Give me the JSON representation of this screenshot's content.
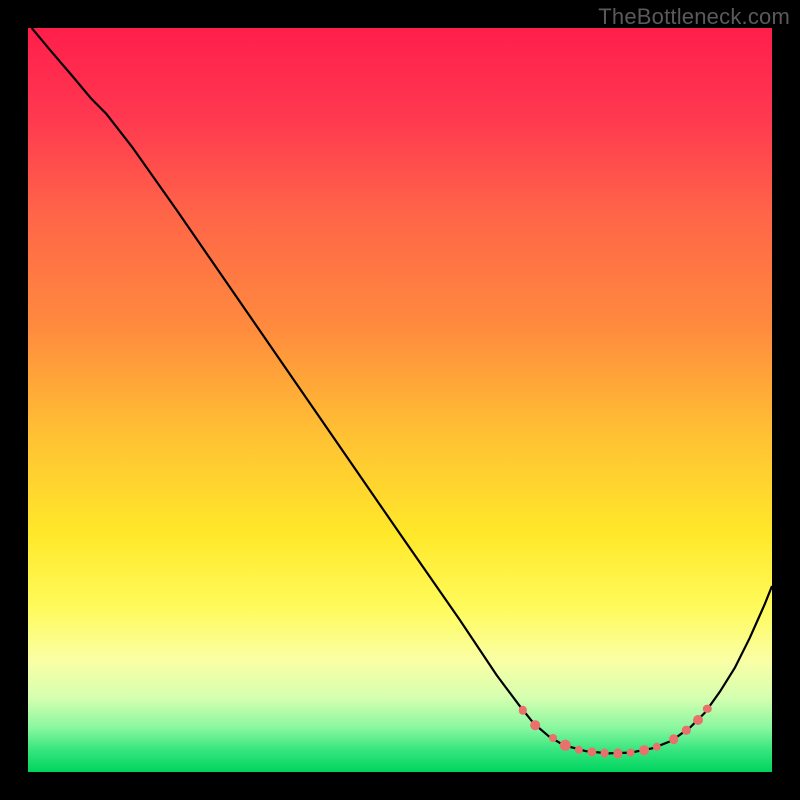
{
  "watermark": "TheBottleneck.com",
  "chart_data": {
    "type": "line",
    "title": "",
    "xlabel": "",
    "ylabel": "",
    "xlim": [
      0,
      100
    ],
    "ylim": [
      0,
      100
    ],
    "gradient_stops": [
      {
        "offset": 0,
        "color": "#ff1e4b"
      },
      {
        "offset": 12,
        "color": "#ff3850"
      },
      {
        "offset": 25,
        "color": "#ff6548"
      },
      {
        "offset": 40,
        "color": "#ff8a3e"
      },
      {
        "offset": 55,
        "color": "#ffc233"
      },
      {
        "offset": 68,
        "color": "#ffe82a"
      },
      {
        "offset": 78,
        "color": "#fffb5c"
      },
      {
        "offset": 85,
        "color": "#faffa5"
      },
      {
        "offset": 90,
        "color": "#d5ffb0"
      },
      {
        "offset": 94,
        "color": "#8bf7a0"
      },
      {
        "offset": 97,
        "color": "#37e67f"
      },
      {
        "offset": 100,
        "color": "#00d45e"
      }
    ],
    "series": [
      {
        "name": "bottleneck-curve",
        "color": "#000000",
        "points": [
          {
            "x": 0.5,
            "y": 100
          },
          {
            "x": 3,
            "y": 97
          },
          {
            "x": 6,
            "y": 93.5
          },
          {
            "x": 8.5,
            "y": 90.5
          },
          {
            "x": 10.5,
            "y": 88.5
          },
          {
            "x": 14,
            "y": 84
          },
          {
            "x": 20,
            "y": 75.5
          },
          {
            "x": 30,
            "y": 61
          },
          {
            "x": 40,
            "y": 46.5
          },
          {
            "x": 50,
            "y": 32
          },
          {
            "x": 58,
            "y": 20.5
          },
          {
            "x": 63,
            "y": 13
          },
          {
            "x": 66,
            "y": 9
          },
          {
            "x": 68,
            "y": 6.5
          },
          {
            "x": 70,
            "y": 4.8
          },
          {
            "x": 72,
            "y": 3.6
          },
          {
            "x": 75,
            "y": 2.8
          },
          {
            "x": 78,
            "y": 2.5
          },
          {
            "x": 81,
            "y": 2.6
          },
          {
            "x": 84,
            "y": 3.2
          },
          {
            "x": 86.5,
            "y": 4.2
          },
          {
            "x": 89,
            "y": 6
          },
          {
            "x": 91,
            "y": 8
          },
          {
            "x": 93,
            "y": 10.8
          },
          {
            "x": 95,
            "y": 14
          },
          {
            "x": 97,
            "y": 18
          },
          {
            "x": 99,
            "y": 22.5
          },
          {
            "x": 100,
            "y": 25
          }
        ]
      }
    ],
    "markers": [
      {
        "x": 66.5,
        "y": 8.3,
        "r": 4.2
      },
      {
        "x": 68.2,
        "y": 6.3,
        "r": 4.8
      },
      {
        "x": 70.5,
        "y": 4.6,
        "r": 4.0
      },
      {
        "x": 72.2,
        "y": 3.6,
        "r": 5.2
      },
      {
        "x": 74.0,
        "y": 3.0,
        "r": 4.2
      },
      {
        "x": 75.8,
        "y": 2.7,
        "r": 4.6
      },
      {
        "x": 77.5,
        "y": 2.5,
        "r": 4.4
      },
      {
        "x": 79.3,
        "y": 2.5,
        "r": 4.6
      },
      {
        "x": 81.0,
        "y": 2.6,
        "r": 4.4
      },
      {
        "x": 82.8,
        "y": 2.9,
        "r": 4.8
      },
      {
        "x": 84.5,
        "y": 3.4,
        "r": 4.2
      },
      {
        "x": 86.8,
        "y": 4.4,
        "r": 4.8
      },
      {
        "x": 88.5,
        "y": 5.6,
        "r": 4.2
      },
      {
        "x": 90.0,
        "y": 7.0,
        "r": 5.0
      },
      {
        "x": 91.3,
        "y": 8.5,
        "r": 4.2
      }
    ]
  }
}
